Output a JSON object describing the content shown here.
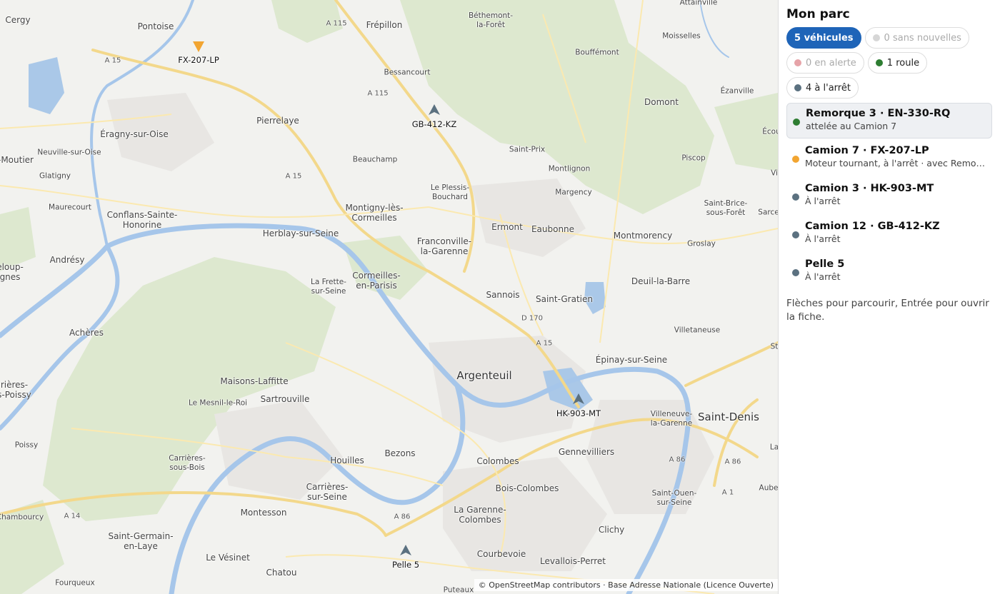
{
  "map": {
    "places": [
      {
        "name": "Cergy"
      },
      {
        "name": "Pontoise"
      },
      {
        "name": "Frépillon"
      },
      {
        "name": "Béthemont-\nla-Forêt"
      },
      {
        "name": "Attainville"
      },
      {
        "name": "Moisselles"
      },
      {
        "name": "Bouffémont"
      },
      {
        "name": "Bessancourt"
      },
      {
        "name": "Ézanville"
      },
      {
        "name": "Pierrelaye"
      },
      {
        "name": "Domont"
      },
      {
        "name": "Éragny-sur-Oise"
      },
      {
        "name": "Neuville-sur-Oise"
      },
      {
        "name": "Beauchamp"
      },
      {
        "name": "Saint-Prix"
      },
      {
        "name": "Piscop"
      },
      {
        "name": "Glatigny"
      },
      {
        "name": "Montlignon"
      },
      {
        "name": "Le Plessis-\nBouchard"
      },
      {
        "name": "Margency"
      },
      {
        "name": "Maurecourt"
      },
      {
        "name": "Conflans-Sainte-\nHonorine"
      },
      {
        "name": "Montigny-lès-\nCormeilles"
      },
      {
        "name": "Saint-Brice-\nsous-Forêt"
      },
      {
        "name": "Herblay-sur-Seine"
      },
      {
        "name": "Ermont"
      },
      {
        "name": "Eaubonne"
      },
      {
        "name": "Montmorency"
      },
      {
        "name": "Franconville-\nla-Garenne"
      },
      {
        "name": "Groslay"
      },
      {
        "name": "Andrésy"
      },
      {
        "name": "La Frette-\nsur-Seine"
      },
      {
        "name": "Cormeilles-\nen-Parisis"
      },
      {
        "name": "Deuil-la-Barre"
      },
      {
        "name": "Sannois"
      },
      {
        "name": "Saint-Gratien"
      },
      {
        "name": "Achères"
      },
      {
        "name": "Villetaneuse"
      },
      {
        "name": "Épinay-sur-Seine"
      },
      {
        "name": "Argenteuil"
      },
      {
        "name": "Maisons-Laffitte"
      },
      {
        "name": "Sartrouville"
      },
      {
        "name": "Le Mesnil-le-Roi"
      },
      {
        "name": "Villeneuve-\nla-Garenne"
      },
      {
        "name": "Saint-Denis"
      },
      {
        "name": "Poissy"
      },
      {
        "name": "Bezons"
      },
      {
        "name": "Carrières-\nsous-Bois"
      },
      {
        "name": "Houilles"
      },
      {
        "name": "Colombes"
      },
      {
        "name": "Gennevilliers"
      },
      {
        "name": "Carrières-\nsur-Seine"
      },
      {
        "name": "Bois-Colombes"
      },
      {
        "name": "Saint-Ouen-\nsur-Seine"
      },
      {
        "name": "Montesson"
      },
      {
        "name": "La Garenne-\nColombes"
      },
      {
        "name": "Chambourcy"
      },
      {
        "name": "Saint-Germain-\nen-Laye"
      },
      {
        "name": "Clichy"
      },
      {
        "name": "Le Vésinet"
      },
      {
        "name": "Courbevoie"
      },
      {
        "name": "Levallois-Perret"
      },
      {
        "name": "Chatou"
      },
      {
        "name": "Fourqueux"
      },
      {
        "name": "Puteaux"
      },
      {
        "name": "-Moutier"
      },
      {
        "name": "eloup-\ngnes"
      },
      {
        "name": "rières-\ns-Poissy"
      },
      {
        "name": "Écou"
      },
      {
        "name": "Vi"
      },
      {
        "name": "Sarce"
      },
      {
        "name": "St"
      },
      {
        "name": "La"
      },
      {
        "name": "Aube"
      }
    ],
    "roads": [
      "A 115",
      "A 115",
      "A 15",
      "A 15",
      "D 170",
      "A 15",
      "A 86",
      "A 86",
      "A 1",
      "A 14",
      "A 86"
    ],
    "markers": [
      {
        "label": "FX-207-LP",
        "color": "#f2a531",
        "shape": "down"
      },
      {
        "label": "GB-412-KZ",
        "color": "#5b7180",
        "shape": "up"
      },
      {
        "label": "HK-903-MT",
        "color": "#5b7180",
        "shape": "up"
      },
      {
        "label": "Pelle 5",
        "color": "#5b7180",
        "shape": "up"
      }
    ],
    "attribution": "© OpenStreetMap contributors · Base Adresse Nationale (Licence Ouverte)"
  },
  "panel": {
    "title": "Mon parc",
    "filters": [
      {
        "label": "5 véhicules",
        "state": "active"
      },
      {
        "label": "0 sans nouvelles",
        "dot": "#d6d6d6",
        "state": "dim"
      },
      {
        "label": "0 en alerte",
        "dot": "#e6a3a8",
        "state": "dim"
      },
      {
        "label": "1 roule",
        "dot": "#2e7d32",
        "state": "normal"
      },
      {
        "label": "4 à l'arrêt",
        "dot": "#5b7180",
        "state": "normal"
      }
    ],
    "vehicles": [
      {
        "title": "Remorque 3 · EN-330-RQ",
        "subtitle": "attelée au Camion 7",
        "dot": "#2e7d32",
        "selected": true
      },
      {
        "title": "Camion 7 · FX-207-LP",
        "subtitle": "Moteur tournant, à l'arrêt · avec Remorque 3",
        "dot": "#f2a531",
        "selected": false
      },
      {
        "title": "Camion 3 · HK-903-MT",
        "subtitle": "À l'arrêt",
        "dot": "#5b7180",
        "selected": false
      },
      {
        "title": "Camion 12 · GB-412-KZ",
        "subtitle": "À l'arrêt",
        "dot": "#5b7180",
        "selected": false
      },
      {
        "title": "Pelle 5",
        "subtitle": "À l'arrêt",
        "dot": "#5b7180",
        "selected": false
      }
    ],
    "hint": "Flèches pour parcourir, Entrée pour ouvrir la fiche."
  }
}
